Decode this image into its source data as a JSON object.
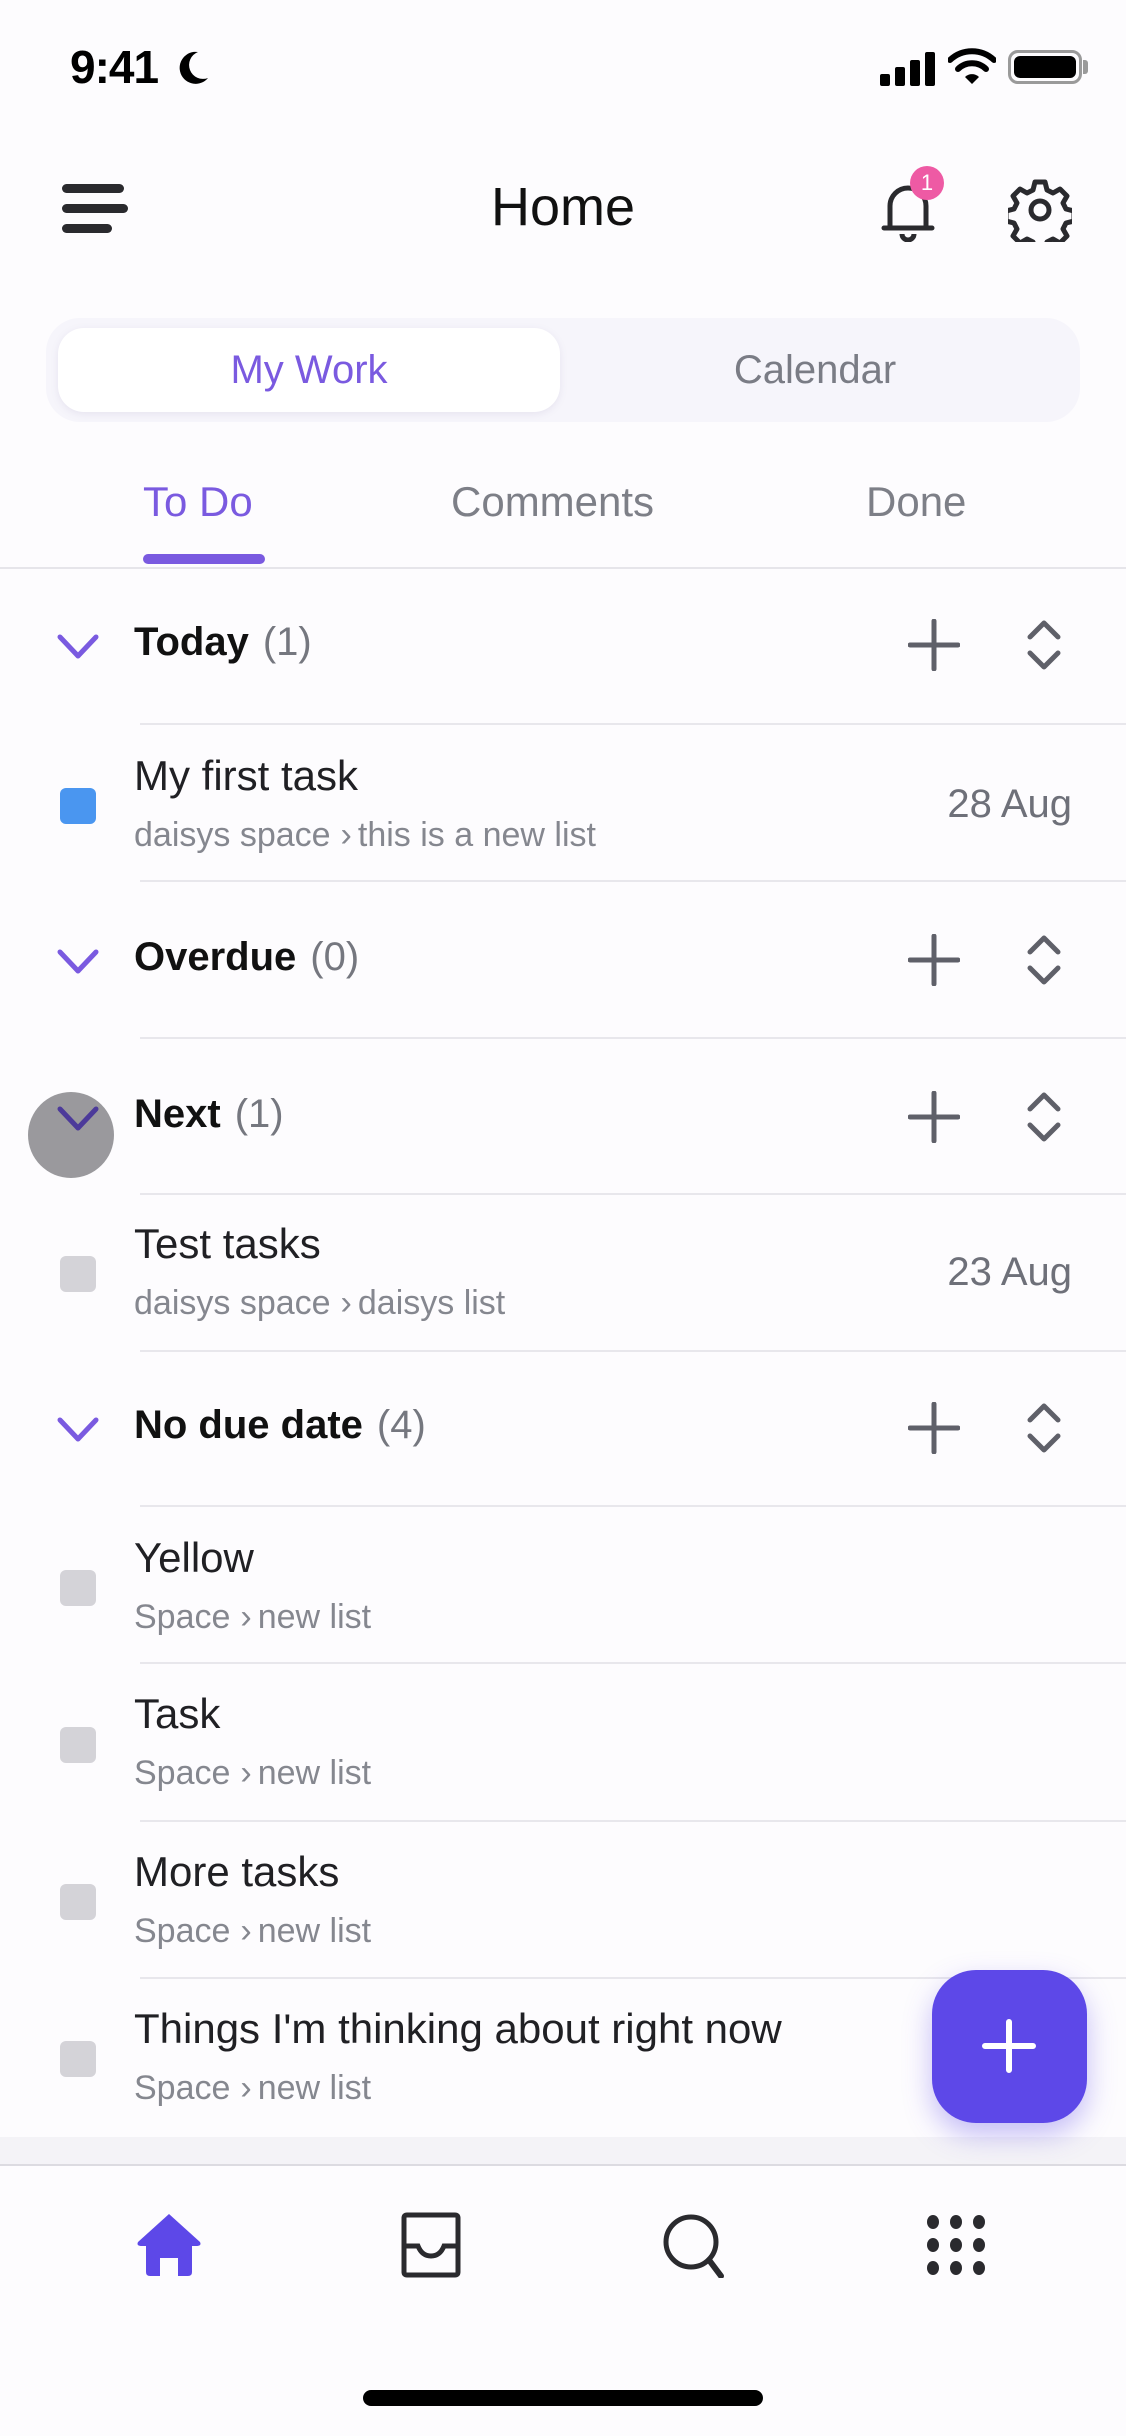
{
  "status_bar": {
    "time": "9:41",
    "focus_icon": "moon-icon",
    "signal_icon": "cellular-signal-icon",
    "wifi_icon": "wifi-icon",
    "battery_icon": "battery-icon"
  },
  "header": {
    "title": "Home",
    "menu_icon": "hamburger-menu-icon",
    "notifications_icon": "bell-icon",
    "notification_count": "1",
    "settings_icon": "gear-icon"
  },
  "segmented": {
    "options": [
      "My Work",
      "Calendar"
    ],
    "selected": "My Work"
  },
  "tabs": {
    "items": [
      "To Do",
      "Comments",
      "Done"
    ],
    "active": "To Do"
  },
  "colors": {
    "accent": "#7a5ae0",
    "fab": "#5d48e8",
    "badge": "#ee5aa4",
    "task_blue": "#4a96f0",
    "task_gray": "#d4d3d8"
  },
  "sections": [
    {
      "title": "Today",
      "count": "(1)",
      "tasks": [
        {
          "name": "My first task",
          "space": "daisys space",
          "list": "this is a new list",
          "date": "28 Aug",
          "status_color": "blue"
        }
      ]
    },
    {
      "title": "Overdue",
      "count": "(0)",
      "tasks": []
    },
    {
      "title": "Next",
      "count": "(1)",
      "tasks": [
        {
          "name": "Test tasks",
          "space": "daisys space",
          "list": "daisys list",
          "date": "23 Aug",
          "status_color": "gray"
        }
      ]
    },
    {
      "title": "No due date",
      "count": "(4)",
      "tasks": [
        {
          "name": "Yellow",
          "space": "Space",
          "list": "new list",
          "date": "",
          "status_color": "gray"
        },
        {
          "name": "Task",
          "space": "Space",
          "list": "new list",
          "date": "",
          "status_color": "gray"
        },
        {
          "name": "More tasks",
          "space": "Space",
          "list": "new list",
          "date": "",
          "status_color": "gray"
        },
        {
          "name": "Things I'm thinking about right now",
          "space": "Space",
          "list": "new list",
          "date": "",
          "status_color": "gray"
        }
      ]
    }
  ],
  "path_separator": "›",
  "fab": {
    "label": "+",
    "icon": "plus-icon"
  },
  "bottom_nav": [
    {
      "name": "home",
      "icon": "home-icon",
      "active": true
    },
    {
      "name": "inbox",
      "icon": "inbox-tray-icon",
      "active": false
    },
    {
      "name": "search",
      "icon": "search-icon",
      "active": false
    },
    {
      "name": "apps",
      "icon": "grid-dots-icon",
      "active": false
    }
  ]
}
